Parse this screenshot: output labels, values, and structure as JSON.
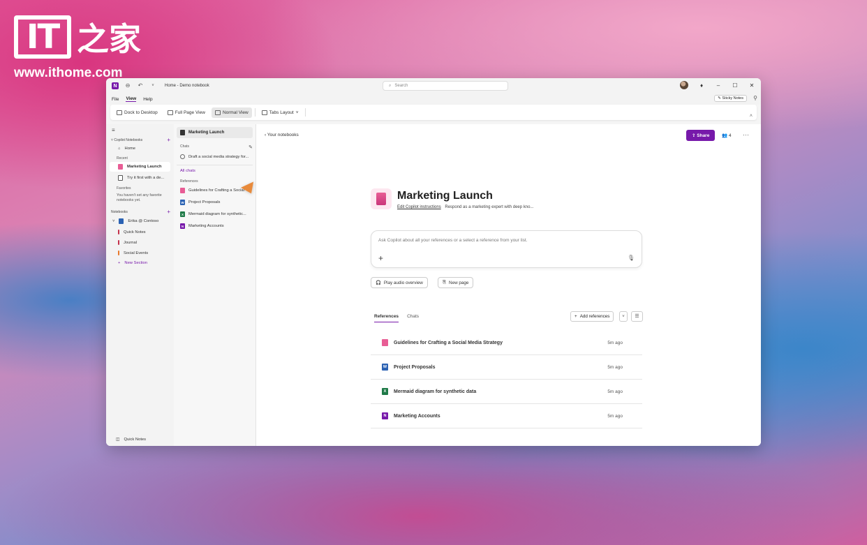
{
  "watermark": {
    "brand": "IT",
    "brand_cn": "之家",
    "url": "www.ithome.com"
  },
  "window": {
    "doc_title": "Home - Demo notebook",
    "search_placeholder": "Search",
    "menu": [
      "File",
      "View",
      "Help"
    ],
    "sticky_notes": "Sticky Notes"
  },
  "ribbon": {
    "dock": "Dock to Desktop",
    "full_page": "Full Page View",
    "normal": "Normal View",
    "tabs_layout": "Tabs Layout"
  },
  "nav": {
    "copilot_notebooks": "Copilot Notebooks",
    "home": "Home",
    "recent": "Recent",
    "recent_items": [
      "Marketing Launch",
      "Try it first with a de..."
    ],
    "favorites": "Favorites",
    "favorites_note": "You haven't set any favorite notebooks yet.",
    "notebooks": "Notebooks",
    "account": "Erika @ Contoso",
    "sections": [
      {
        "label": "Quick Notes",
        "color": "#c4314b"
      },
      {
        "label": "Journal",
        "color": "#c4314b"
      },
      {
        "label": "Social Events",
        "color": "#e8792b"
      }
    ],
    "new_section": "New Section",
    "bottom": "Quick Notes"
  },
  "refs_pane": {
    "notebook": "Marketing Launch",
    "chats_label": "Chats",
    "chat_item": "Draft a social media strategy for...",
    "all_chats": "All chats",
    "references_label": "References",
    "items": [
      {
        "label": "Guidelines for Crafting a Social",
        "color": "#e85d95",
        "glyph": ""
      },
      {
        "label": "Project Proposals",
        "color": "#2b62b3",
        "glyph": "W"
      },
      {
        "label": "Mermaid diagram for synthetic...",
        "color": "#1f7a48",
        "glyph": "X"
      },
      {
        "label": "Marketing Accounts",
        "color": "#7719aa",
        "glyph": "N"
      }
    ]
  },
  "main": {
    "back": "Your notebooks",
    "share": "Share",
    "people_count": "4",
    "title": "Marketing Launch",
    "edit_instructions": "Edit Copilot instructions",
    "instructions_preview": "Respond as a marketing expert with deep kno...",
    "ask_placeholder": "Ask Copilot about all your references or a select a reference from your list.",
    "play_audio": "Play audio overview",
    "new_page": "New page",
    "tabs": [
      "References",
      "Chats"
    ],
    "add_references": "Add references",
    "references": [
      {
        "name": "Guidelines for Crafting a Social Media Strategy",
        "time": "5m ago",
        "color": "#e85d95",
        "glyph": ""
      },
      {
        "name": "Project Proposals",
        "time": "5m ago",
        "color": "#2b62b3",
        "glyph": "W"
      },
      {
        "name": "Mermaid diagram for synthetic data",
        "time": "5m ago",
        "color": "#1f7a48",
        "glyph": "X"
      },
      {
        "name": "Marketing Accounts",
        "time": "5m ago",
        "color": "#7719aa",
        "glyph": "N"
      }
    ]
  }
}
